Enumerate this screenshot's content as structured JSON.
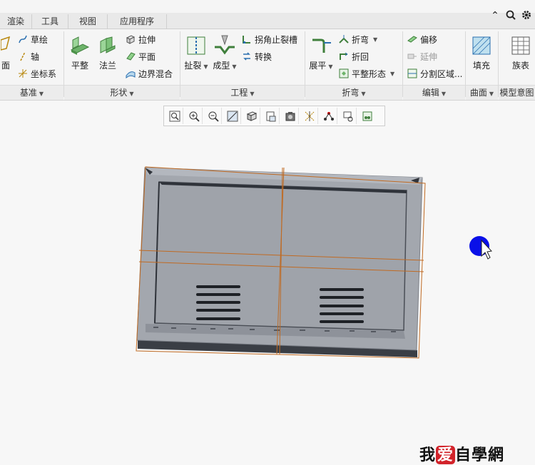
{
  "tabs": [
    "渲染",
    "工具",
    "视图",
    "应用程序"
  ],
  "top_right_icons": [
    "chevron-up-icon",
    "search-icon",
    "gear-icon"
  ],
  "groups": {
    "jizhun": {
      "label": "基准",
      "items": {
        "face": "面",
        "sketch": "草绘",
        "axis": "轴",
        "csys": "坐标系"
      }
    },
    "xingzhuang": {
      "label": "形状",
      "items": {
        "flat": "平整",
        "flange": "法兰",
        "extrude": "拉伸",
        "plane": "平面",
        "boundary_blend": "边界混合"
      }
    },
    "gongcheng": {
      "label": "工程",
      "items": {
        "rip": "扯裂",
        "form": "成型",
        "corner_relief": "拐角止裂槽",
        "convert": "转换"
      }
    },
    "zhewan": {
      "label": "折弯",
      "items": {
        "unbend": "展平",
        "bend": "折弯",
        "bend_back": "折回",
        "flat_state": "平整形态"
      }
    },
    "bianji": {
      "label": "编辑",
      "items": {
        "offset": "偏移",
        "extend": "延伸",
        "split_area": "分割区域..."
      }
    },
    "qumian": {
      "label": "曲面",
      "items": {
        "fill": "填充"
      }
    },
    "moxing": {
      "label": "模型意图",
      "items": {
        "family_table": "族表"
      }
    }
  },
  "graphics_toolbar": [
    "zoom-fit-icon",
    "zoom-in-icon",
    "zoom-out-icon",
    "repaint-icon",
    "display-style-icon",
    "saved-views-icon",
    "view-manager-icon",
    "datum-display-icon",
    "annotation-display-icon",
    "spin-center-icon",
    "appearance-icon"
  ],
  "watermark": {
    "prefix": "我",
    "heart": "爱",
    "suffix": "自學網"
  },
  "colors": {
    "accent": "#2b6cb0",
    "model_face": "#a3a7ae",
    "datum_orange": "#c06a22",
    "cursor_blue": "#0a10e8"
  }
}
